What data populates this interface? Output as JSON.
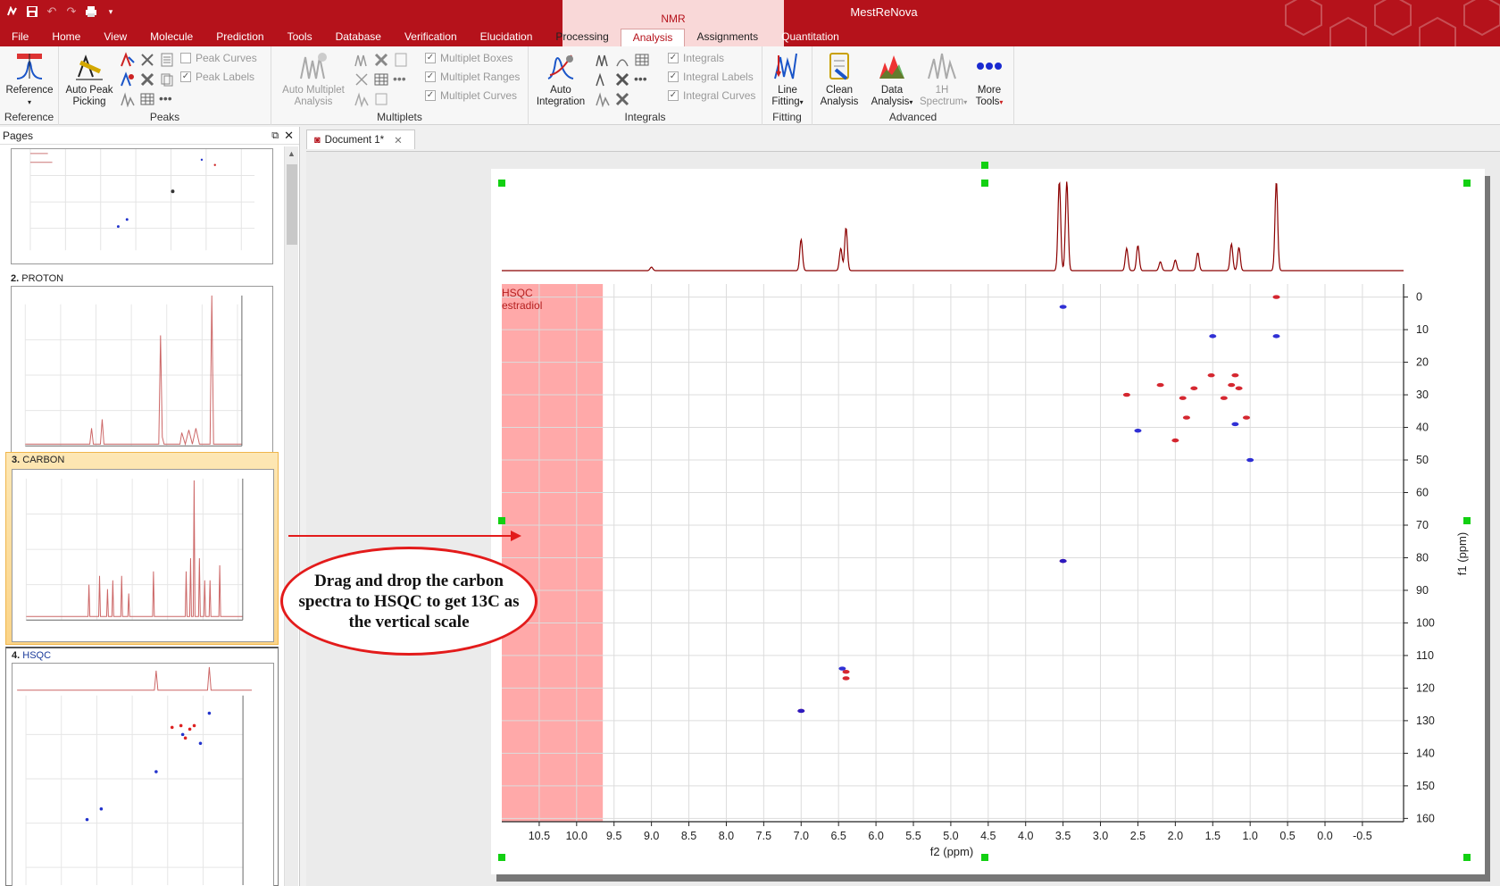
{
  "app_title": "MestReNova",
  "nmr_context_label": "NMR",
  "menus": [
    {
      "label": "File",
      "ctx": false,
      "active": false
    },
    {
      "label": "Home",
      "ctx": false,
      "active": false
    },
    {
      "label": "View",
      "ctx": false,
      "active": false
    },
    {
      "label": "Molecule",
      "ctx": false,
      "active": false
    },
    {
      "label": "Prediction",
      "ctx": false,
      "active": false
    },
    {
      "label": "Tools",
      "ctx": false,
      "active": false
    },
    {
      "label": "Database",
      "ctx": false,
      "active": false
    },
    {
      "label": "Verification",
      "ctx": false,
      "active": false
    },
    {
      "label": "Elucidation",
      "ctx": false,
      "active": false
    },
    {
      "label": "Processing",
      "ctx": true,
      "active": false
    },
    {
      "label": "Analysis",
      "ctx": true,
      "active": true
    },
    {
      "label": "Assignments",
      "ctx": true,
      "active": false
    },
    {
      "label": "Quantitation",
      "ctx": false,
      "active": false
    }
  ],
  "ribbon": {
    "reference": {
      "button": "Reference",
      "group": "Reference"
    },
    "peaks": {
      "auto_peak": "Auto Peak Picking",
      "group": "Peaks",
      "peak_curves": "Peak Curves",
      "peak_labels": "Peak Labels"
    },
    "multiplets": {
      "auto": "Auto Multiplet Analysis",
      "group": "Multiplets",
      "boxes": "Multiplet Boxes",
      "ranges": "Multiplet Ranges",
      "curves": "Multiplet Curves"
    },
    "integrals": {
      "auto": "Auto Integration",
      "group": "Integrals",
      "integrals": "Integrals",
      "labels": "Integral Labels",
      "curves": "Integral Curves"
    },
    "fitting": {
      "line": "Line Fitting",
      "group": "Fitting"
    },
    "advanced": {
      "clean": "Clean Analysis",
      "data": "Data Analysis",
      "spectrum": "1H Spectrum",
      "more": "More Tools",
      "group": "Advanced"
    }
  },
  "pages_panel": {
    "title": "Pages",
    "pages": [
      {
        "num": "2.",
        "name": "PROTON"
      },
      {
        "num": "3.",
        "name": "CARBON"
      },
      {
        "num": "4.",
        "name": "HSQC"
      }
    ]
  },
  "document_tab": "Document 1*",
  "plot": {
    "label_line1": "HSQC",
    "label_line2": "estradiol",
    "xlabel": "f2 (ppm)",
    "ylabel": "f1 (ppm)"
  },
  "callout_text": "Drag and drop  the carbon spectra to HSQC to get 13C as the vertical scale",
  "colors": {
    "brand": "#b5121b",
    "positive_peaks": "#d0101a",
    "negative_peaks": "#1a1ad0",
    "spectrum_line": "#8b0000",
    "highlight_region": "#ff9a9a"
  },
  "chart_data": {
    "type": "scatter",
    "xlabel": "f2 (ppm)",
    "ylabel": "f1 (ppm)",
    "xlim": [
      11.0,
      -1.05
    ],
    "ylim": [
      -4,
      161
    ],
    "x_ticks": [
      10.5,
      10.0,
      9.5,
      9.0,
      8.5,
      8.0,
      7.5,
      7.0,
      6.5,
      6.0,
      5.5,
      5.0,
      4.5,
      4.0,
      3.5,
      3.0,
      2.5,
      2.0,
      1.5,
      1.0,
      0.5,
      0.0,
      -0.5
    ],
    "y_ticks": [
      0,
      10,
      20,
      30,
      40,
      50,
      60,
      70,
      80,
      90,
      100,
      110,
      120,
      130,
      140,
      150,
      160
    ],
    "grid": true,
    "series": [
      {
        "values": [
          {
            "x": 7.0,
            "y": 127
          },
          {
            "x": 6.4,
            "y": 115
          },
          {
            "x": 6.4,
            "y": 117
          },
          {
            "x": 3.5,
            "y": 81
          },
          {
            "x": 2.65,
            "y": 30
          },
          {
            "x": 2.2,
            "y": 27
          },
          {
            "x": 2.0,
            "y": 44
          },
          {
            "x": 1.85,
            "y": 37
          },
          {
            "x": 1.9,
            "y": 31
          },
          {
            "x": 1.75,
            "y": 28
          },
          {
            "x": 1.52,
            "y": 24
          },
          {
            "x": 1.35,
            "y": 31
          },
          {
            "x": 1.25,
            "y": 27
          },
          {
            "x": 1.2,
            "y": 24
          },
          {
            "x": 1.15,
            "y": 28
          },
          {
            "x": 1.05,
            "y": 37
          },
          {
            "x": 0.65,
            "y": 0
          }
        ]
      },
      {
        "values": [
          {
            "x": 6.45,
            "y": 114
          },
          {
            "x": 7.0,
            "y": 127
          },
          {
            "x": 3.5,
            "y": 81
          },
          {
            "x": 0.65,
            "y": 12
          },
          {
            "x": 2.5,
            "y": 41
          },
          {
            "x": 1.2,
            "y": 39
          },
          {
            "x": 1.0,
            "y": 50
          },
          {
            "x": 1.5,
            "y": 12
          },
          {
            "x": 3.5,
            "y": 3
          }
        ]
      }
    ],
    "highlight_xrange": [
      11.0,
      9.65
    ],
    "proton_projection_peaks": [
      {
        "x": 7.0,
        "h": 0.35
      },
      {
        "x": 6.47,
        "h": 0.25
      },
      {
        "x": 6.4,
        "h": 0.48
      },
      {
        "x": 3.55,
        "h": 1.0
      },
      {
        "x": 3.45,
        "h": 1.0
      },
      {
        "x": 2.65,
        "h": 0.25
      },
      {
        "x": 2.5,
        "h": 0.28
      },
      {
        "x": 2.2,
        "h": 0.1
      },
      {
        "x": 2.0,
        "h": 0.12
      },
      {
        "x": 1.7,
        "h": 0.2
      },
      {
        "x": 1.25,
        "h": 0.3
      },
      {
        "x": 1.15,
        "h": 0.26
      },
      {
        "x": 0.65,
        "h": 1.0
      },
      {
        "x": 9.0,
        "h": 0.04
      }
    ]
  }
}
